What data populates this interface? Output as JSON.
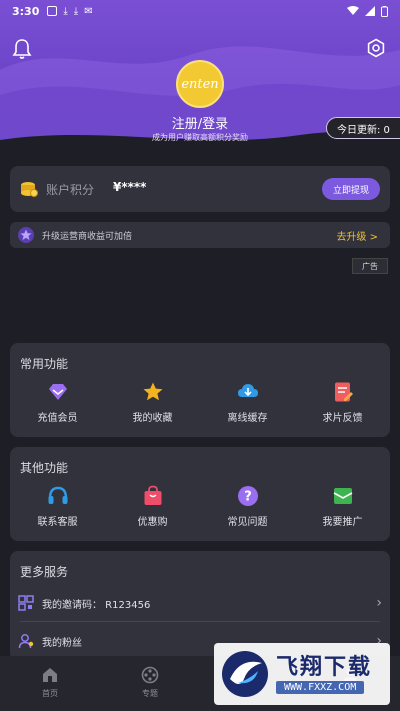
{
  "status_bar": {
    "time": "3:30"
  },
  "header": {
    "logo_text": "enten",
    "login_label": "注册/登录",
    "login_subtitle": "成为用户赚取高额积分奖励",
    "today_update_label": "今日更新: 0",
    "colors": {
      "gradient_top": "#7a4fd4",
      "gradient_bottom": "#5c3db3"
    }
  },
  "points": {
    "label": "账户积分",
    "value": "¥****",
    "withdraw_label": "立即提现"
  },
  "upgrade": {
    "text": "升级运营商收益可加倍",
    "link_label": "去升级 >"
  },
  "ad_tag": "广告",
  "common_functions": {
    "title": "常用功能",
    "items": [
      {
        "label": "充值会员",
        "icon": "diamond-icon",
        "color": "#9b6df0"
      },
      {
        "label": "我的收藏",
        "icon": "star-icon",
        "color": "#f3b21e"
      },
      {
        "label": "离线缓存",
        "icon": "cloud-download-icon",
        "color": "#2f9be6"
      },
      {
        "label": "求片反馈",
        "icon": "feedback-icon",
        "color": "#ef5d5d"
      }
    ]
  },
  "other_functions": {
    "title": "其他功能",
    "items": [
      {
        "label": "联系客服",
        "icon": "headset-icon",
        "color": "#2f9be6"
      },
      {
        "label": "优惠购",
        "icon": "shopping-bag-icon",
        "color": "#ef4d6a"
      },
      {
        "label": "常见问题",
        "icon": "question-icon",
        "color": "#9b6df0"
      },
      {
        "label": "我要推广",
        "icon": "promote-icon",
        "color": "#3fb34f"
      }
    ]
  },
  "more_services": {
    "title": "更多服务",
    "rows": [
      {
        "label": "我的邀请码：  R123456",
        "icon": "qr-icon"
      },
      {
        "label": "我的粉丝",
        "icon": "fans-icon"
      }
    ]
  },
  "tabbar": {
    "tabs": [
      {
        "label": "首页",
        "icon": "home-icon"
      },
      {
        "label": "专题",
        "icon": "film-icon"
      },
      {
        "label": "",
        "icon": ""
      },
      {
        "label": "",
        "icon": ""
      }
    ]
  },
  "watermark": {
    "title": "飞翔下载",
    "url": "WWW.FXXZ.COM"
  }
}
